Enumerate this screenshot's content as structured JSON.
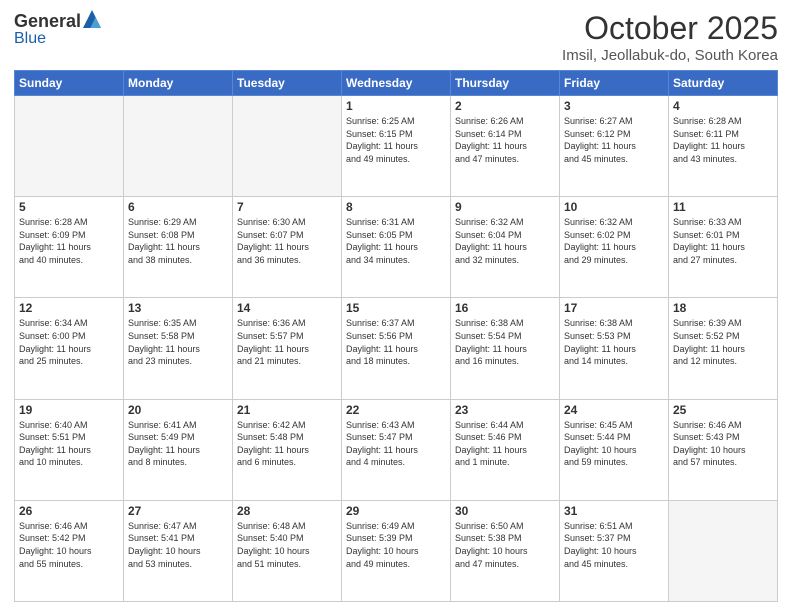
{
  "header": {
    "logo_general": "General",
    "logo_blue": "Blue",
    "month_title": "October 2025",
    "subtitle": "Imsil, Jeollabuk-do, South Korea"
  },
  "days_of_week": [
    "Sunday",
    "Monday",
    "Tuesday",
    "Wednesday",
    "Thursday",
    "Friday",
    "Saturday"
  ],
  "weeks": [
    [
      {
        "day": "",
        "info": ""
      },
      {
        "day": "",
        "info": ""
      },
      {
        "day": "",
        "info": ""
      },
      {
        "day": "1",
        "info": "Sunrise: 6:25 AM\nSunset: 6:15 PM\nDaylight: 11 hours\nand 49 minutes."
      },
      {
        "day": "2",
        "info": "Sunrise: 6:26 AM\nSunset: 6:14 PM\nDaylight: 11 hours\nand 47 minutes."
      },
      {
        "day": "3",
        "info": "Sunrise: 6:27 AM\nSunset: 6:12 PM\nDaylight: 11 hours\nand 45 minutes."
      },
      {
        "day": "4",
        "info": "Sunrise: 6:28 AM\nSunset: 6:11 PM\nDaylight: 11 hours\nand 43 minutes."
      }
    ],
    [
      {
        "day": "5",
        "info": "Sunrise: 6:28 AM\nSunset: 6:09 PM\nDaylight: 11 hours\nand 40 minutes."
      },
      {
        "day": "6",
        "info": "Sunrise: 6:29 AM\nSunset: 6:08 PM\nDaylight: 11 hours\nand 38 minutes."
      },
      {
        "day": "7",
        "info": "Sunrise: 6:30 AM\nSunset: 6:07 PM\nDaylight: 11 hours\nand 36 minutes."
      },
      {
        "day": "8",
        "info": "Sunrise: 6:31 AM\nSunset: 6:05 PM\nDaylight: 11 hours\nand 34 minutes."
      },
      {
        "day": "9",
        "info": "Sunrise: 6:32 AM\nSunset: 6:04 PM\nDaylight: 11 hours\nand 32 minutes."
      },
      {
        "day": "10",
        "info": "Sunrise: 6:32 AM\nSunset: 6:02 PM\nDaylight: 11 hours\nand 29 minutes."
      },
      {
        "day": "11",
        "info": "Sunrise: 6:33 AM\nSunset: 6:01 PM\nDaylight: 11 hours\nand 27 minutes."
      }
    ],
    [
      {
        "day": "12",
        "info": "Sunrise: 6:34 AM\nSunset: 6:00 PM\nDaylight: 11 hours\nand 25 minutes."
      },
      {
        "day": "13",
        "info": "Sunrise: 6:35 AM\nSunset: 5:58 PM\nDaylight: 11 hours\nand 23 minutes."
      },
      {
        "day": "14",
        "info": "Sunrise: 6:36 AM\nSunset: 5:57 PM\nDaylight: 11 hours\nand 21 minutes."
      },
      {
        "day": "15",
        "info": "Sunrise: 6:37 AM\nSunset: 5:56 PM\nDaylight: 11 hours\nand 18 minutes."
      },
      {
        "day": "16",
        "info": "Sunrise: 6:38 AM\nSunset: 5:54 PM\nDaylight: 11 hours\nand 16 minutes."
      },
      {
        "day": "17",
        "info": "Sunrise: 6:38 AM\nSunset: 5:53 PM\nDaylight: 11 hours\nand 14 minutes."
      },
      {
        "day": "18",
        "info": "Sunrise: 6:39 AM\nSunset: 5:52 PM\nDaylight: 11 hours\nand 12 minutes."
      }
    ],
    [
      {
        "day": "19",
        "info": "Sunrise: 6:40 AM\nSunset: 5:51 PM\nDaylight: 11 hours\nand 10 minutes."
      },
      {
        "day": "20",
        "info": "Sunrise: 6:41 AM\nSunset: 5:49 PM\nDaylight: 11 hours\nand 8 minutes."
      },
      {
        "day": "21",
        "info": "Sunrise: 6:42 AM\nSunset: 5:48 PM\nDaylight: 11 hours\nand 6 minutes."
      },
      {
        "day": "22",
        "info": "Sunrise: 6:43 AM\nSunset: 5:47 PM\nDaylight: 11 hours\nand 4 minutes."
      },
      {
        "day": "23",
        "info": "Sunrise: 6:44 AM\nSunset: 5:46 PM\nDaylight: 11 hours\nand 1 minute."
      },
      {
        "day": "24",
        "info": "Sunrise: 6:45 AM\nSunset: 5:44 PM\nDaylight: 10 hours\nand 59 minutes."
      },
      {
        "day": "25",
        "info": "Sunrise: 6:46 AM\nSunset: 5:43 PM\nDaylight: 10 hours\nand 57 minutes."
      }
    ],
    [
      {
        "day": "26",
        "info": "Sunrise: 6:46 AM\nSunset: 5:42 PM\nDaylight: 10 hours\nand 55 minutes."
      },
      {
        "day": "27",
        "info": "Sunrise: 6:47 AM\nSunset: 5:41 PM\nDaylight: 10 hours\nand 53 minutes."
      },
      {
        "day": "28",
        "info": "Sunrise: 6:48 AM\nSunset: 5:40 PM\nDaylight: 10 hours\nand 51 minutes."
      },
      {
        "day": "29",
        "info": "Sunrise: 6:49 AM\nSunset: 5:39 PM\nDaylight: 10 hours\nand 49 minutes."
      },
      {
        "day": "30",
        "info": "Sunrise: 6:50 AM\nSunset: 5:38 PM\nDaylight: 10 hours\nand 47 minutes."
      },
      {
        "day": "31",
        "info": "Sunrise: 6:51 AM\nSunset: 5:37 PM\nDaylight: 10 hours\nand 45 minutes."
      },
      {
        "day": "",
        "info": ""
      }
    ]
  ]
}
